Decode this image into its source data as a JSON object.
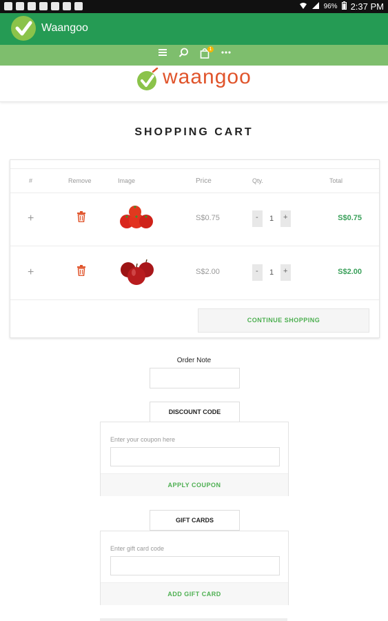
{
  "status_bar": {
    "time": "2:37 PM",
    "battery": "96%"
  },
  "app_bar": {
    "title": "Waangoo"
  },
  "toolbar": {
    "cart_count": "1",
    "icons": [
      "menu-icon",
      "search-icon",
      "cart-icon",
      "more-icon"
    ]
  },
  "brand": {
    "name": "waangoo"
  },
  "page_title": "SHOPPING CART",
  "cart": {
    "headers": {
      "index": "#",
      "remove": "Remove",
      "image": "Image",
      "price": "Price",
      "qty": "Qty.",
      "total": "Total"
    },
    "rows": [
      {
        "expand": "+",
        "product": "tomatoes",
        "price": "S$0.75",
        "qty": "1",
        "total": "S$0.75"
      },
      {
        "expand": "+",
        "product": "apples",
        "price": "S$2.00",
        "qty": "1",
        "total": "S$2.00"
      }
    ],
    "qty_minus": "-",
    "qty_plus": "+",
    "continue_label": "CONTINUE SHOPPING"
  },
  "order_note": {
    "label": "Order Note"
  },
  "discount": {
    "tab_label": "DISCOUNT CODE",
    "placeholder_label": "Enter your coupon here",
    "button_label": "APPLY COUPON"
  },
  "gift": {
    "tab_label": "GIFT CARDS",
    "placeholder_label": "Enter gift card code",
    "button_label": "ADD GIFT CARD"
  },
  "colors": {
    "primary_green": "#259b54",
    "light_green": "#7ebe6d",
    "accent_orange": "#e0542b",
    "price_green": "#3aa05a"
  }
}
